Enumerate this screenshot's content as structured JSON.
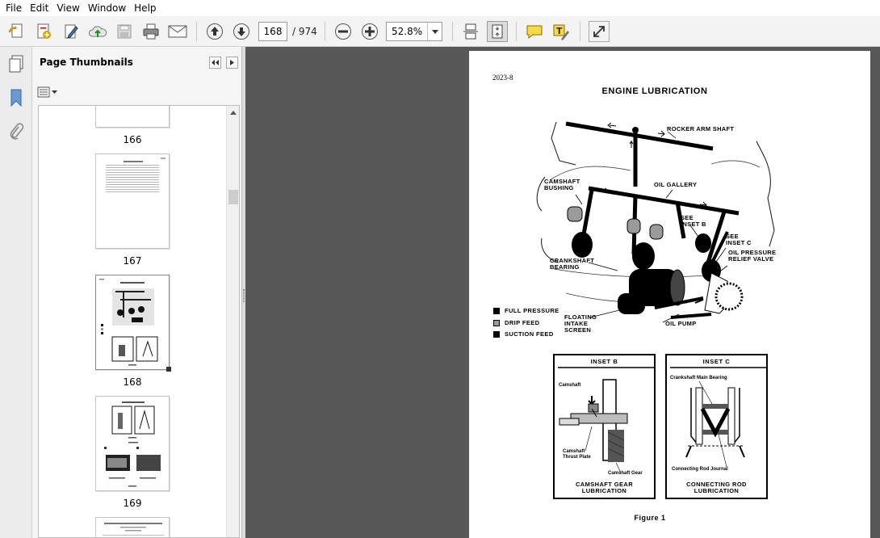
{
  "menu": [
    "File",
    "Edit",
    "View",
    "Window",
    "Help"
  ],
  "toolbar": {
    "current_page": "168",
    "page_total": "/ 974",
    "zoom": "52.8%"
  },
  "panel": {
    "title": "Page Thumbnails",
    "thumbnails": [
      {
        "label": "166"
      },
      {
        "label": "167"
      },
      {
        "label": "168"
      },
      {
        "label": "169"
      }
    ]
  },
  "page": {
    "number": "2023-8",
    "title": "ENGINE LUBRICATION",
    "labels": {
      "rocker": "ROCKER ARM SHAFT",
      "cam_bushing": "CAMSHAFT\nBUSHING",
      "gallery": "OIL GALLERY",
      "inset_b_ref": "SEE\nINSET B",
      "inset_c_ref": "SEE\nINSET C",
      "relief": "OIL PRESSURE\nRELIEF VALVE",
      "crank": "CRANKSHAFT\nBEARING",
      "screen": "FLOATING\nINTAKE\nSCREEN",
      "pump": "OIL PUMP"
    },
    "legend": [
      {
        "label": "FULL PRESSURE",
        "color": "#000000"
      },
      {
        "label": "DRIP FEED",
        "color": "#9a9a9a"
      },
      {
        "label": "SUCTION FEED",
        "color": "#000000"
      }
    ],
    "inset_b": {
      "title": "INSET B",
      "camshaft": "Camshaft",
      "thrust": "Camshaft\nThrust Plate",
      "gear": "Camshaft Gear",
      "caption": "CAMSHAFT GEAR\nLUBRICATION"
    },
    "inset_c": {
      "title": "INSET C",
      "main_bearing": "Crankshaft Main Bearing",
      "rod_journal": "Connecting Rod Journal",
      "caption": "CONNECTING ROD\nLUBRICATION"
    },
    "figure": "Figure 1"
  }
}
